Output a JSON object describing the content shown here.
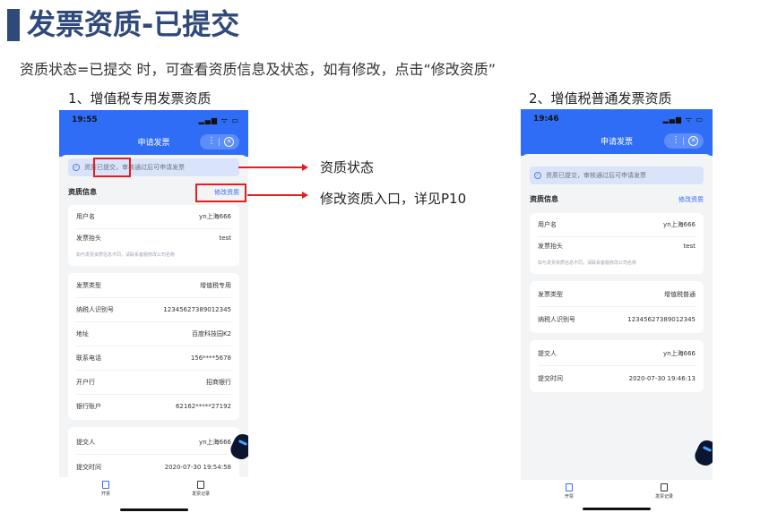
{
  "slide": {
    "title": "发票资质-已提交",
    "subtitle": "资质状态=已提交 时，可查看资质信息及状态，如有修改，点击“修改资质”",
    "caption_left": "1、增值税专用发票资质",
    "caption_right": "2、增值税普通发票资质"
  },
  "annotations": {
    "status_label": "资质状态",
    "edit_label": "修改资质入口，详见P10"
  },
  "phone_left": {
    "time": "19:55",
    "status_icons": "▂▄▆ ᯤ ▭",
    "nav_title": "申请发票",
    "capsule_dots": "⋮",
    "capsule_close": "✕",
    "notice": "资质已提交，审核通过后可申请发票",
    "section_title": "资质信息",
    "edit_link": "修改资质",
    "user": {
      "label": "用户名",
      "value": "yn上海666"
    },
    "header": {
      "label": "发票抬头",
      "value": "test"
    },
    "hint": "如与发票资质信息不同，请联系客服修改公司名称",
    "invoice_rows": [
      {
        "label": "发票类型",
        "value": "增值税专用"
      },
      {
        "label": "纳税人识别号",
        "value": "12345627389012345"
      },
      {
        "label": "地址",
        "value": "百度科技园K2"
      },
      {
        "label": "联系电话",
        "value": "156****5678"
      },
      {
        "label": "开户行",
        "value": "招商银行"
      },
      {
        "label": "银行账户",
        "value": "62162*****27192"
      }
    ],
    "submit_rows": [
      {
        "label": "提交人",
        "value": "yn上海666"
      },
      {
        "label": "提交时间",
        "value": "2020-07-30 19:54:58"
      }
    ],
    "tabs": [
      {
        "label": "开票"
      },
      {
        "label": "发票记录"
      }
    ]
  },
  "phone_right": {
    "time": "19:46",
    "status_icons": "▂▄▆ ᯤ ▭",
    "nav_title": "申请发票",
    "capsule_dots": "⋮",
    "capsule_close": "✕",
    "notice": "资质已提交，审核通过后可申请发票",
    "section_title": "资质信息",
    "edit_link": "修改资质",
    "user": {
      "label": "用户名",
      "value": "yn上海666"
    },
    "header": {
      "label": "发票抬头",
      "value": "test"
    },
    "hint": "如与发票资质信息不同，请联系客服修改公司名称",
    "invoice_rows": [
      {
        "label": "发票类型",
        "value": "增值税普通"
      },
      {
        "label": "纳税人识别号",
        "value": "12345627389012345"
      }
    ],
    "submit_rows": [
      {
        "label": "提交人",
        "value": "yn上海666"
      },
      {
        "label": "提交时间",
        "value": "2020-07-30 19:46:13"
      }
    ],
    "tabs": [
      {
        "label": "开票"
      },
      {
        "label": "发票记录"
      }
    ]
  },
  "colors": {
    "accent": "#2f6df6",
    "title": "#2f4a7a",
    "annotation": "#e02020",
    "notice_bg": "#d9e4fb"
  }
}
